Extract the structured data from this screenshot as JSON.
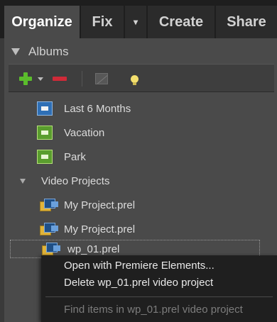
{
  "tabs": {
    "organize": "Organize",
    "fix": "Fix",
    "fix_dropdown": "▾",
    "create": "Create",
    "share": "Share"
  },
  "albums": {
    "title": "Albums",
    "items": [
      {
        "label": "Last 6 Months",
        "icon": "smart-album-icon",
        "color": "#2f6fb5"
      },
      {
        "label": "Vacation",
        "icon": "album-icon",
        "color": "#5a9d2e"
      },
      {
        "label": "Park",
        "icon": "album-icon",
        "color": "#5a9d2e"
      }
    ],
    "video_projects": {
      "label": "Video Projects",
      "items": [
        {
          "label": "My Project.prel"
        },
        {
          "label": "My Project.prel"
        },
        {
          "label": "wp_01.prel"
        }
      ]
    }
  },
  "toolbar": {
    "add_icon": "plus-icon",
    "remove_icon": "minus-icon",
    "edit_icon": "edit-album-icon",
    "tip_icon": "lightbulb-icon"
  },
  "context_menu": {
    "open": "Open with Premiere Elements...",
    "delete": "Delete wp_01.prel video project",
    "find": "Find items in wp_01.prel video project"
  },
  "colors": {
    "add": "#5bbd2c",
    "remove": "#cf2a38",
    "tip": "#f3df6e"
  }
}
